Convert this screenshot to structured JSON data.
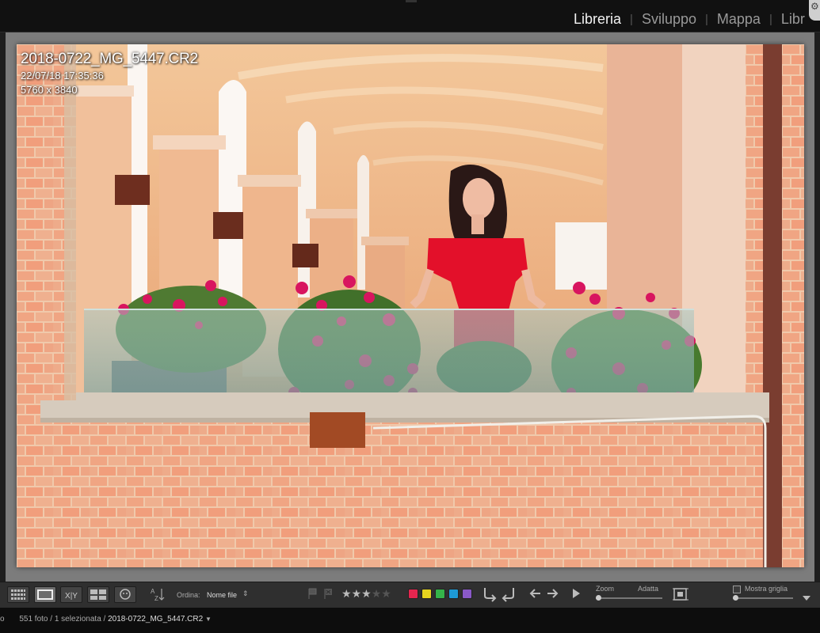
{
  "modules": {
    "items": [
      "Libreria",
      "Sviluppo",
      "Mappa",
      "Libr"
    ],
    "active_index": 0
  },
  "photo": {
    "filename": "2018-0722_MG_5447.CR2",
    "datetime": "22/07/18 17:35:36",
    "dimensions": "5760 x 3840"
  },
  "toolbar": {
    "sort_label": "Ordina:",
    "sort_value": "Nome file",
    "rating": {
      "value": 3,
      "max": 5
    },
    "color_labels": [
      "#e5264f",
      "#e7d51f",
      "#35b44a",
      "#1d9ad6",
      "#8a59c8"
    ],
    "zoom_label": "Zoom",
    "fit_label": "Adatta",
    "show_grid_label": "Mostra griglia"
  },
  "filmstrip": {
    "path_prefix": "o",
    "count_text": "551 foto / 1 selezionata /",
    "current_file": "2018-0722_MG_5447.CR2"
  }
}
